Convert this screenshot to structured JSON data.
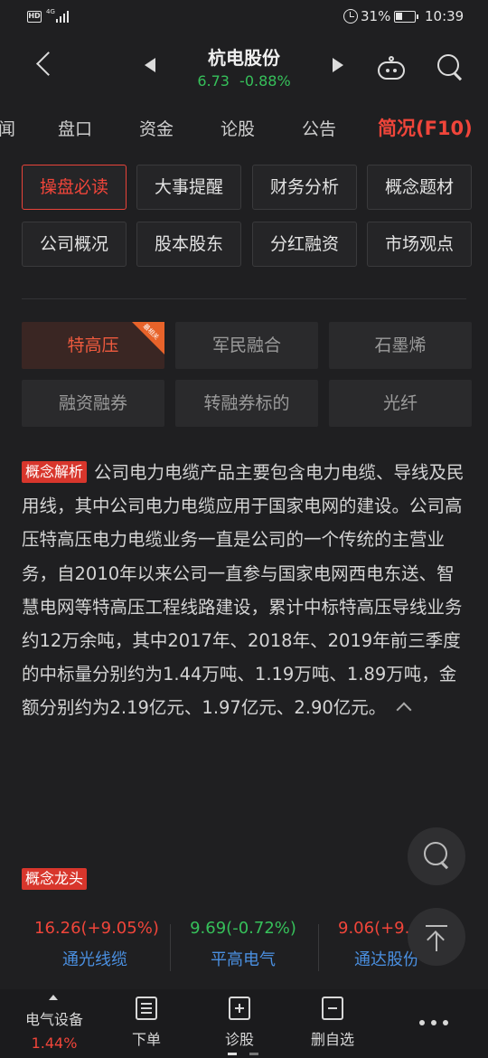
{
  "status_bar": {
    "hd": "HD",
    "network": "4G",
    "battery_pct": "31%",
    "time": "10:39"
  },
  "header": {
    "stock_name": "杭电股份",
    "price": "6.73",
    "change": "-0.88%",
    "price_color": "#36c05a"
  },
  "tabs": [
    {
      "label": "闻"
    },
    {
      "label": "盘口"
    },
    {
      "label": "资金"
    },
    {
      "label": "论股"
    },
    {
      "label": "公告"
    },
    {
      "label": "简况(F10)",
      "active": true
    }
  ],
  "f10_buttons": [
    {
      "label": "操盘必读",
      "active": true
    },
    {
      "label": "大事提醒"
    },
    {
      "label": "财务分析"
    },
    {
      "label": "概念题材"
    },
    {
      "label": "公司概况"
    },
    {
      "label": "股本股东"
    },
    {
      "label": "分红融资"
    },
    {
      "label": "市场观点"
    }
  ],
  "concepts": [
    {
      "label": "特高压",
      "active": true,
      "badge": "最相关"
    },
    {
      "label": "军民融合"
    },
    {
      "label": "石墨烯"
    },
    {
      "label": "融资融券"
    },
    {
      "label": "转融券标的"
    },
    {
      "label": "光纤"
    }
  ],
  "analysis": {
    "tag": "概念解析",
    "text": "公司电力电缆产品主要包含电力电缆、导线及民用线，其中公司电力电缆应用于国家电网的建设。公司高压特高压电力电缆业务一直是公司的一个传统的主营业务，自2010年以来公司一直参与国家电网西电东送、智慧电网等特高压工程线路建设，累计中标特高压导线业务约12万余吨，其中2017年、2018年、2019年前三季度的中标量分别约为1.44万吨、1.19万吨、1.89万吨，金额分别约为2.19亿元、1.97亿元、2.90亿元。"
  },
  "leaders": {
    "tag": "概念龙头",
    "items": [
      {
        "quote": "16.26(+9.05%)",
        "name": "通光线缆",
        "color": "#f0453a"
      },
      {
        "quote": "9.69(-0.72%)",
        "name": "平高电气",
        "color": "#36c05a"
      },
      {
        "quote": "9.06(+9.9",
        "name": "通达股份",
        "color": "#f0453a"
      }
    ]
  },
  "bottom_bar": {
    "sector_name": "电气设备",
    "sector_pct": "1.44%",
    "items": [
      {
        "label": "下单",
        "icon": "order-icon"
      },
      {
        "label": "诊股",
        "icon": "diagnose-icon"
      },
      {
        "label": "删自选",
        "icon": "remove-watchlist-icon"
      }
    ],
    "more_icon": "more-icon"
  }
}
